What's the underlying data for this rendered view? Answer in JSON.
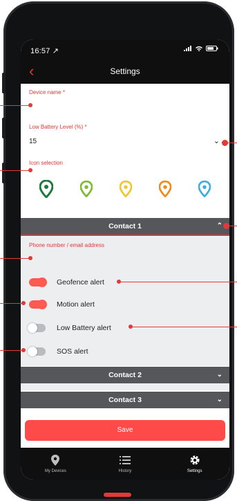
{
  "status": {
    "time": "16:57 ↗"
  },
  "header": {
    "title": "Settings",
    "back_glyph": "‹"
  },
  "device_name": {
    "label": "Device name *",
    "value": ""
  },
  "low_battery": {
    "label": "Low Battery Level (%) *",
    "value": "15"
  },
  "icon_selection": {
    "label": "Icon selection",
    "pin_colors": [
      "#1e7a3a",
      "#7dbb2e",
      "#f2c52b",
      "#f28a1a",
      "#3aaee0"
    ]
  },
  "contact1": {
    "title": "Contact 1",
    "phone_label": "Phone number / email address",
    "geofence_label": "Geofence alert",
    "motion_label": "Motion alert",
    "lowbattery_label": "Low Battery alert",
    "sos_label": "SOS alert",
    "toggles": {
      "geofence": true,
      "motion": true,
      "lowbattery": false,
      "sos": false
    }
  },
  "contact2": {
    "title": "Contact 2"
  },
  "contact3": {
    "title": "Contact 3"
  },
  "save": {
    "label": "Save"
  },
  "tabbar": {
    "my_devices": "My Devices",
    "history": "History",
    "settings": "Settings"
  },
  "colors": {
    "accent": "#e53935",
    "save": "#ff4a4a",
    "section_header": "#56575b",
    "toggle_on": "#ff5a4f",
    "toggle_off": "#b9bcbf"
  }
}
